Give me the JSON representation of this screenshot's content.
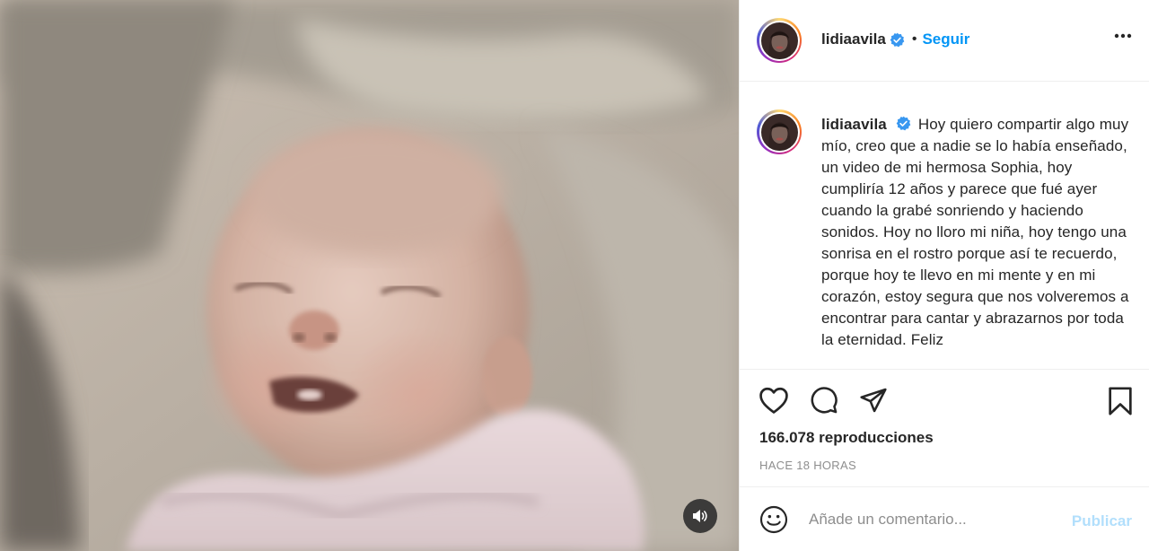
{
  "post": {
    "username": "lidiaavila",
    "follow_label": "Seguir",
    "separator": "•",
    "caption": "Hoy quiero compartir algo muy mío, creo que a nadie se lo había enseñado, un video de mi hermosa Sophia, hoy cumpliría 12 años y parece que fué ayer cuando la grabé sonriendo y haciendo sonidos. Hoy no lloro mi niña, hoy tengo una sonrisa en el rostro porque así te recuerdo, porque hoy te llevo en mi mente y en mi corazón, estoy segura que nos volveremos a encontrar para cantar y abrazarnos por toda la eternidad. Feliz",
    "views": "166.078 reproducciones",
    "time_ago": "HACE 18 HORAS"
  },
  "comment_bar": {
    "placeholder": "Añade un comentario...",
    "publish_label": "Publicar"
  },
  "icons": {
    "verified": "verified-badge-icon",
    "more": "more-options-icon",
    "like": "heart-icon",
    "comment": "comment-icon",
    "share": "share-icon",
    "save": "bookmark-icon",
    "emoji": "emoji-icon",
    "audio": "speaker-icon"
  },
  "colors": {
    "link_blue": "#0095f6",
    "publish_disabled": "#b2dffc",
    "verified_blue": "#3897f0",
    "muted_text": "#8e8e8e"
  }
}
